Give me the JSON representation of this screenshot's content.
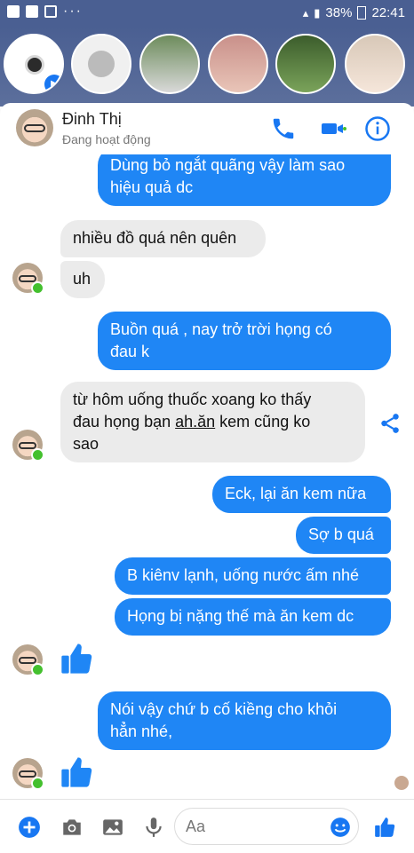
{
  "status_bar": {
    "battery": "38%",
    "time": "22:41"
  },
  "chat_heads": {
    "names": [
      "camera-head",
      "messenger-head",
      "contact-1",
      "contact-2",
      "contact-3",
      "contact-4"
    ]
  },
  "header": {
    "name": "Đinh Thị",
    "status": "Đang hoạt động",
    "icons": [
      "phone-icon",
      "video-icon",
      "info-icon"
    ],
    "accent": "#1877f2"
  },
  "messages": [
    {
      "side": "out",
      "lines": [
        "Dùng bỏ ngắt quãng vậy làm sao",
        "hiệu quả dc"
      ]
    },
    {
      "side": "in",
      "lines": [
        "nhiều đồ quá nên quên"
      ]
    },
    {
      "side": "in",
      "lines": [
        "uh"
      ]
    },
    {
      "side": "out",
      "lines": [
        "Buồn quá , nay trở trời họng có",
        "đau k"
      ]
    },
    {
      "side": "in",
      "lines": [
        "từ hôm uống thuốc xoang ko thấy",
        "đau họng bạn ",
        "ah.ăn",
        " kem cũng ko",
        "sao"
      ]
    },
    {
      "side": "out",
      "lines": [
        "Eck, lại ăn kem nữa"
      ]
    },
    {
      "side": "out",
      "lines": [
        "Sợ b quá"
      ]
    },
    {
      "side": "out",
      "lines": [
        "B kiênv lạnh, uống nước ấm nhé"
      ]
    },
    {
      "side": "out",
      "lines": [
        "Họng bị nặng thế mà ăn kem dc"
      ]
    },
    {
      "side": "out",
      "lines": [
        "Nói vậy chứ b cố kiềng cho khỏi",
        "hẳn nhé,"
      ]
    }
  ],
  "composer": {
    "placeholder": "Aa"
  },
  "colors": {
    "outgoing_bubble": "#1f86f5",
    "incoming_bubble": "#ebebeb",
    "online_dot": "#44c02e"
  }
}
